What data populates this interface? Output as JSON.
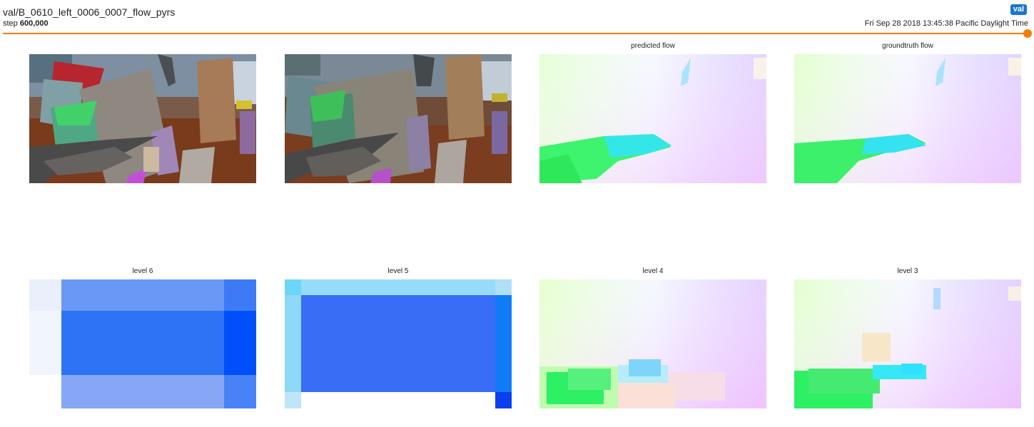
{
  "card": {
    "title": "val/B_0610_left_0006_0007_flow_pyrs",
    "tag": "val",
    "step_label": "step",
    "step_value": "600,000",
    "wall_time": "Fri Sep 28 2018 13:45:38 Pacific Daylight Time",
    "slider_fraction": 1.0
  },
  "panels": [
    {
      "title": "",
      "kind": "rgb-frame-1"
    },
    {
      "title": "",
      "kind": "rgb-frame-2"
    },
    {
      "title": "predicted flow",
      "kind": "flow"
    },
    {
      "title": "groundtruth flow",
      "kind": "flow"
    },
    {
      "title": "level 6",
      "kind": "flow-pyramid"
    },
    {
      "title": "level 5",
      "kind": "flow-pyramid"
    },
    {
      "title": "level 4",
      "kind": "flow-pyramid"
    },
    {
      "title": "level 3",
      "kind": "flow-pyramid"
    }
  ],
  "colors": {
    "accent": "#f57c00",
    "tag_bg": "#1976d2"
  }
}
